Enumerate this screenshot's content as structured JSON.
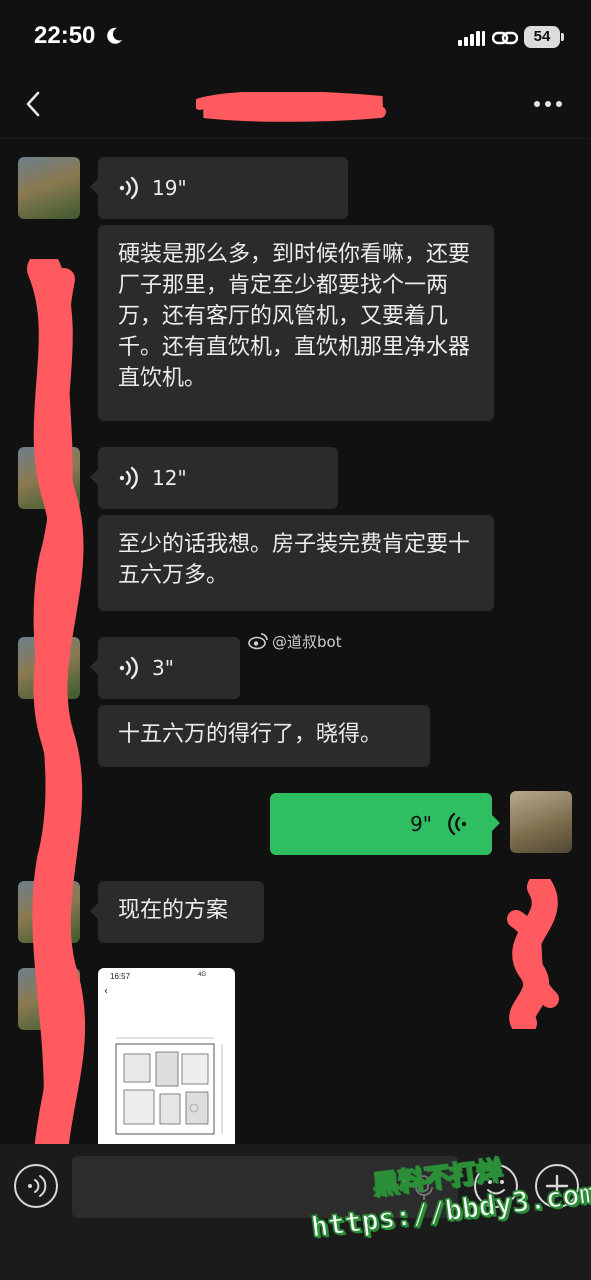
{
  "status_bar": {
    "time": "22:50",
    "battery": "54",
    "icons": [
      "moon-icon",
      "signal-icon",
      "link-icon",
      "battery-icon"
    ]
  },
  "header": {
    "title_redacted": true,
    "back_icon": "chevron-left-icon",
    "more_icon": "more-dots-icon"
  },
  "messages": [
    {
      "sender": "contact",
      "type": "voice",
      "duration": "19\""
    },
    {
      "sender": "contact",
      "type": "transcript",
      "text": "硬装是那么多，到时候你看嘛，还要厂子那里，肯定至少都要找个一两万，还有客厅的风管机，又要着几千。还有直饮机，直饮机那里净水器直饮机。"
    },
    {
      "sender": "contact",
      "type": "voice",
      "duration": "12\""
    },
    {
      "sender": "contact",
      "type": "transcript",
      "text": "至少的话我想。房子装完费肯定要十五六万多。"
    },
    {
      "sender": "contact",
      "type": "voice",
      "duration": "3\""
    },
    {
      "sender": "contact",
      "type": "transcript",
      "text": "十五六万的得行了，晓得。"
    },
    {
      "sender": "me",
      "type": "voice",
      "duration": "9\""
    },
    {
      "sender": "contact",
      "type": "text",
      "text": "现在的方案"
    },
    {
      "sender": "contact",
      "type": "image",
      "thumb_time": "16:57",
      "thumb_status": "4G"
    }
  ],
  "watermarks": {
    "weibo": "@道叔bot",
    "site_line1": "黑料不打烊",
    "site_line2": "https://bbdy3.com"
  },
  "input": {
    "value": "",
    "placeholder": ""
  },
  "colors": {
    "background": "#111111",
    "bubble_contact": "#2b2b2b",
    "bubble_me": "#2fbf62",
    "redaction": "#ff5a5f"
  }
}
